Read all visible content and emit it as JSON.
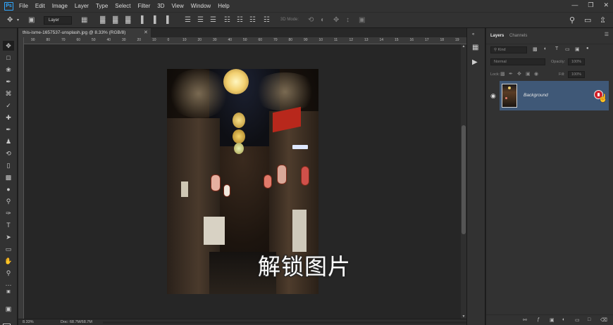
{
  "app": {
    "logo": "Ps"
  },
  "menu": [
    "File",
    "Edit",
    "Image",
    "Layer",
    "Type",
    "Select",
    "Filter",
    "3D",
    "View",
    "Window",
    "Help"
  ],
  "window_controls": [
    "minimize-icon",
    "restore-icon",
    "close-icon"
  ],
  "options": {
    "auto_select_value": "Layer",
    "mode_3d_label": "3D Mode:"
  },
  "document": {
    "tab_title": "this-isme-1657537-unsplash.jpg @ 8.33% (RGB/8)",
    "ruler_ticks": [
      "90",
      "80",
      "70",
      "60",
      "50",
      "40",
      "30",
      "20",
      "10",
      "0",
      "10",
      "20",
      "30",
      "40",
      "50",
      "60",
      "70",
      "80",
      "90",
      "10",
      "11",
      "12",
      "13",
      "14",
      "15",
      "16",
      "17",
      "18",
      "19"
    ],
    "overlay_text": "解锁图片"
  },
  "status": {
    "zoom": "8.33%",
    "doc_size": "Doc: 68.7M/68.7M"
  },
  "layers_panel": {
    "tabs": [
      "Layers",
      "Channels"
    ],
    "filter_label": "Kind",
    "blend_mode": "Normal",
    "opacity_label": "Opacity:",
    "opacity_value": "100%",
    "lock_label": "Lock:",
    "fill_label": "Fill:",
    "fill_value": "100%",
    "layer_name": "Background"
  },
  "colors": {
    "selected_layer": "#3f5877",
    "lock_badge": "#d0202a",
    "accent": "#31a8ff"
  }
}
